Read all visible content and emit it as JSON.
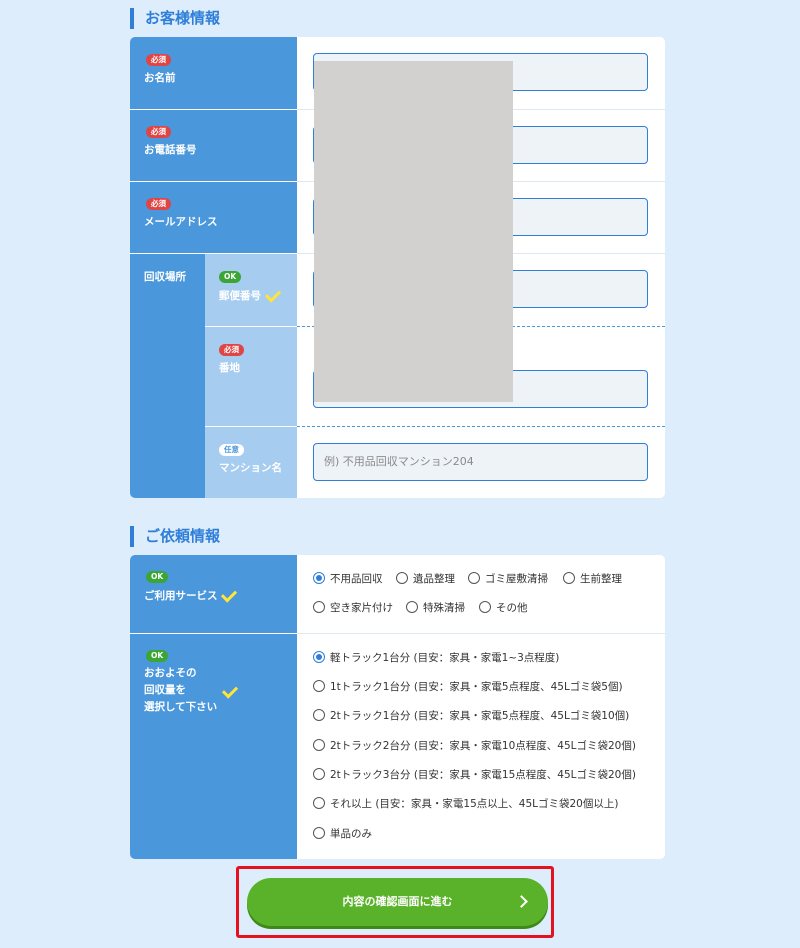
{
  "customer_section": {
    "title": "お客様情報",
    "fields": {
      "name": {
        "badge": "必須",
        "label": "お名前"
      },
      "phone": {
        "badge": "必須",
        "label": "お電話番号"
      },
      "email": {
        "badge": "必須",
        "label": "メールアドレス"
      },
      "location": {
        "label": "回収場所",
        "postal": {
          "badge": "OK",
          "label": "郵便番号"
        },
        "address": {
          "badge": "必須",
          "label": "番地"
        },
        "building": {
          "badge": "任意",
          "label": "マンション名",
          "placeholder": "例) 不用品回収マンション204"
        }
      }
    }
  },
  "request_section": {
    "title": "ご依頼情報",
    "service": {
      "badge": "OK",
      "label": "ご利用サービス",
      "options": [
        "不用品回収",
        "遺品整理",
        "ゴミ屋敷清掃",
        "生前整理",
        "空き家片付け",
        "特殊清掃",
        "その他"
      ],
      "selected": "不用品回収"
    },
    "volume": {
      "badge": "OK",
      "label_lines": [
        "おおよその",
        "回収量を",
        "選択して下さい"
      ],
      "options": [
        "軽トラック1台分 (目安：家具・家電1~3点程度)",
        "1tトラック1台分 (目安：家具・家電5点程度、45Lゴミ袋5個)",
        "2tトラック1台分 (目安：家具・家電5点程度、45Lゴミ袋10個)",
        "2tトラック2台分 (目安：家具・家電10点程度、45Lゴミ袋20個)",
        "2tトラック3台分 (目安：家具・家電15点程度、45Lゴミ袋20個)",
        "それ以上 (目安：家具・家電15点以上、45Lゴミ袋20個以上)",
        "単品のみ"
      ],
      "selected": "軽トラック1台分 (目安：家具・家電1~3点程度)"
    }
  },
  "submit_button": {
    "label": "内容の確認画面に進む",
    "icon": "chevron-right-icon"
  },
  "colors": {
    "accent": "#2f7ed8",
    "label_bg": "#4a97db",
    "sub_label_bg": "#a6ccf0",
    "cta": "#5ab22a",
    "highlight_frame": "#e3121e"
  }
}
